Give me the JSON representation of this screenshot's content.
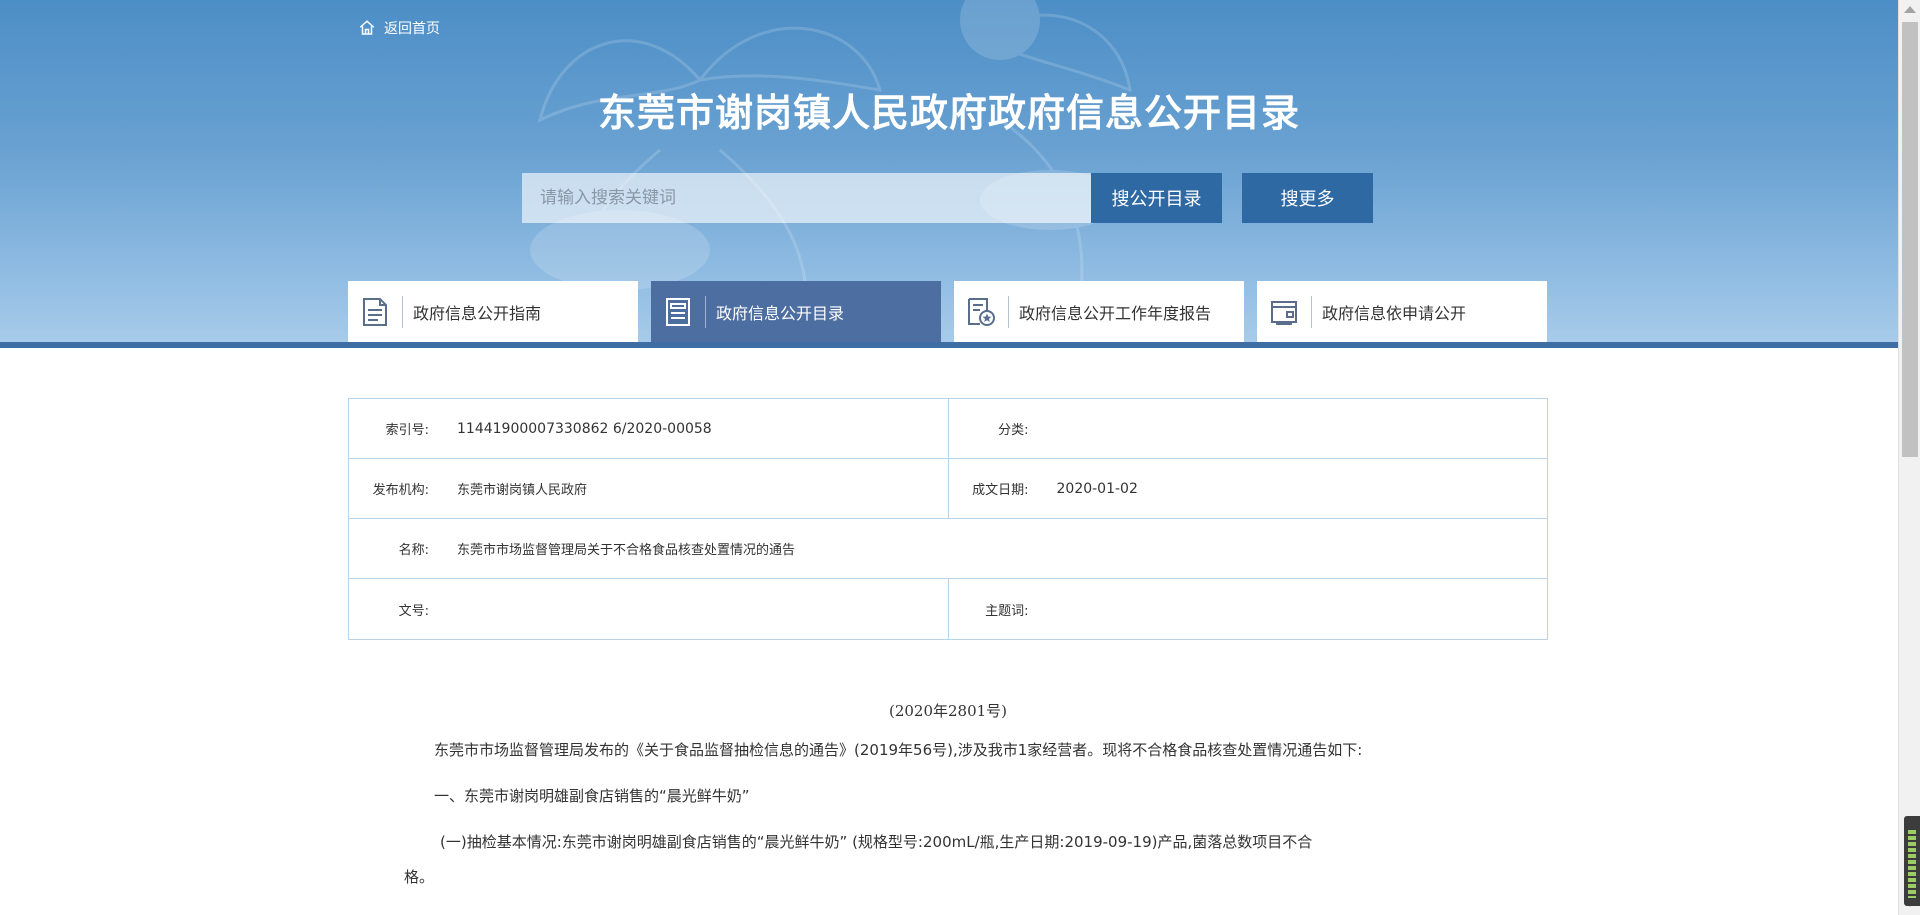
{
  "header": {
    "back_home_label": "返回首页",
    "title": "东莞市谢岗镇人民政府政府信息公开目录",
    "search": {
      "placeholder": "请输入搜索关键词",
      "value": "",
      "catalog_button": "搜公开目录",
      "more_button": "搜更多"
    }
  },
  "tabs": [
    {
      "label": "政府信息公开指南",
      "icon": "document-list-icon",
      "active": false
    },
    {
      "label": "政府信息公开目录",
      "icon": "catalog-icon",
      "active": true
    },
    {
      "label": "政府信息公开工作年度报告",
      "icon": "report-badge-icon",
      "active": false
    },
    {
      "label": "政府信息依申请公开",
      "icon": "application-icon",
      "active": false
    }
  ],
  "info": {
    "index_label": "索引号:",
    "index_value": "11441900007330862 6/2020-00058",
    "category_label": "分类:",
    "category_value": "",
    "publisher_label": "发布机构:",
    "publisher_value": "东莞市谢岗镇人民政府",
    "date_label": "成文日期:",
    "date_value": "2020-01-02",
    "name_label": "名称:",
    "name_value": "东莞市市场监督管理局关于不合格食品核查处置情况的通告",
    "docno_label": "文号:",
    "docno_value": "",
    "keywords_label": "主题词:",
    "keywords_value": ""
  },
  "article": {
    "doc_number": "(2020年2801号)",
    "paragraphs": [
      "东莞市市场监督管理局发布的《关于食品监督抽检信息的通告》(2019年56号),涉及我市1家经营者。现将不合格食品核查处置情况通告如下:",
      "一、东莞市谢岗明雄副食店销售的“晨光鲜牛奶”",
      "(一)抽检基本情况:东莞市谢岗明雄副食店销售的“晨光鲜牛奶” (规格型号:200mL/瓶,生产日期:2019-09-19)产品,菌落总数项目不合",
      "格。"
    ]
  },
  "colors": {
    "header_top": "#4c8ec6",
    "stripe": "#3f6ea5",
    "button": "#2e69a4",
    "active_tab": "#4d6ea1",
    "table_border": "#b9d3e8"
  }
}
